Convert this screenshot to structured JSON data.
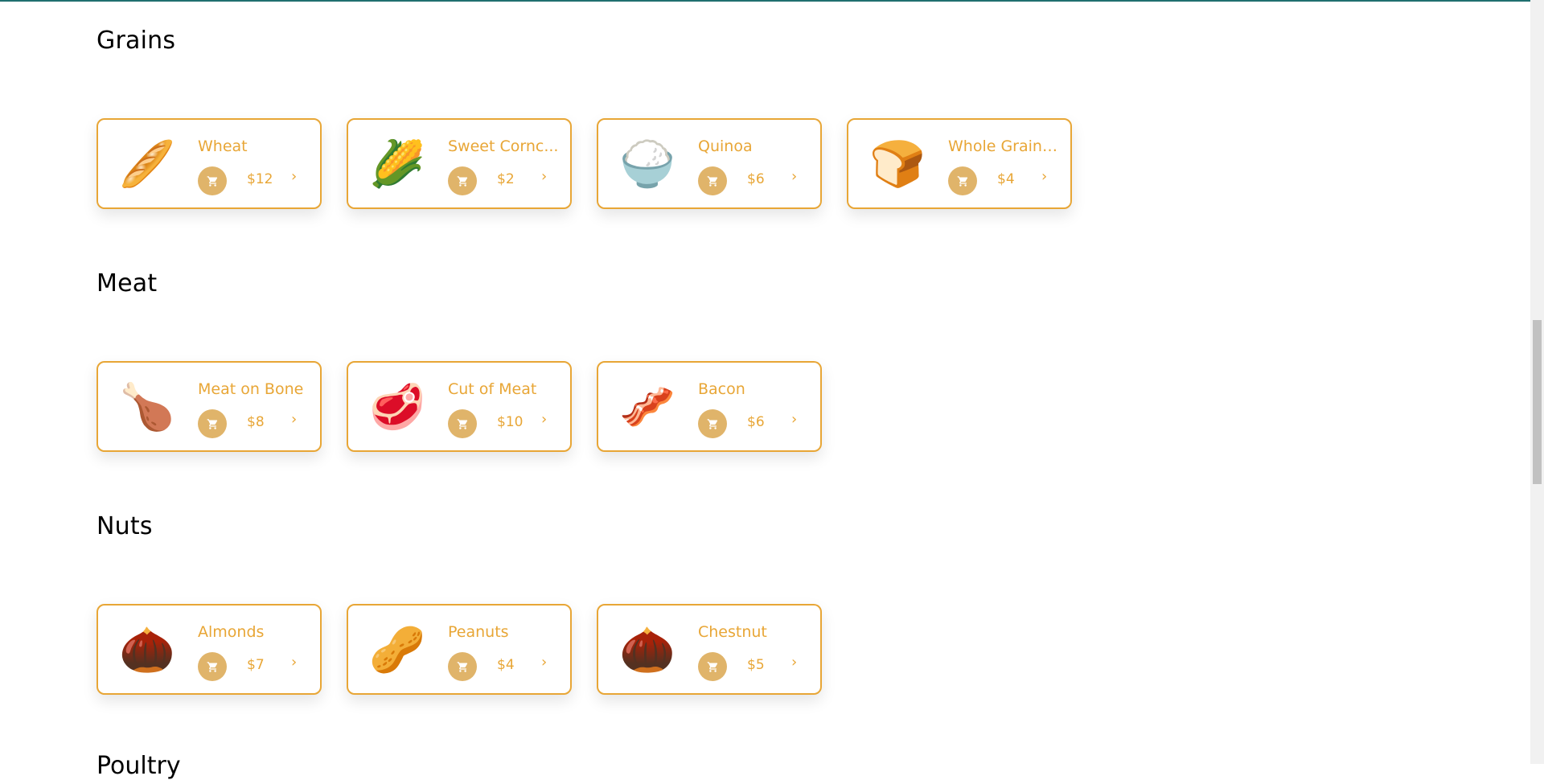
{
  "accent_color": "#e8a636",
  "cart_button_color": "#e0b46a",
  "sections": [
    {
      "title": "Grains",
      "products": [
        {
          "name": "Wheat",
          "price": "$12",
          "emoji": "🥖"
        },
        {
          "name": "Sweet Cornc...",
          "price": "$2",
          "emoji": "🌽"
        },
        {
          "name": "Quinoa",
          "price": "$6",
          "emoji": "🍚"
        },
        {
          "name": "Whole Grain ...",
          "price": "$4",
          "emoji": "🍞"
        }
      ]
    },
    {
      "title": "Meat",
      "products": [
        {
          "name": "Meat on Bone",
          "price": "$8",
          "emoji": "🍗"
        },
        {
          "name": "Cut of Meat",
          "price": "$10",
          "emoji": "🥩"
        },
        {
          "name": "Bacon",
          "price": "$6",
          "emoji": "🥓"
        }
      ]
    },
    {
      "title": "Nuts",
      "products": [
        {
          "name": "Almonds",
          "price": "$7",
          "emoji": "🌰"
        },
        {
          "name": "Peanuts",
          "price": "$4",
          "emoji": "🥜"
        },
        {
          "name": "Chestnut",
          "price": "$5",
          "emoji": "🌰"
        }
      ]
    }
  ],
  "next_section_partial_title": "Poultry",
  "icons": {
    "cart": "shopping-cart-icon",
    "chevron": "chevron-right-icon"
  },
  "chevron_glyph": "›"
}
